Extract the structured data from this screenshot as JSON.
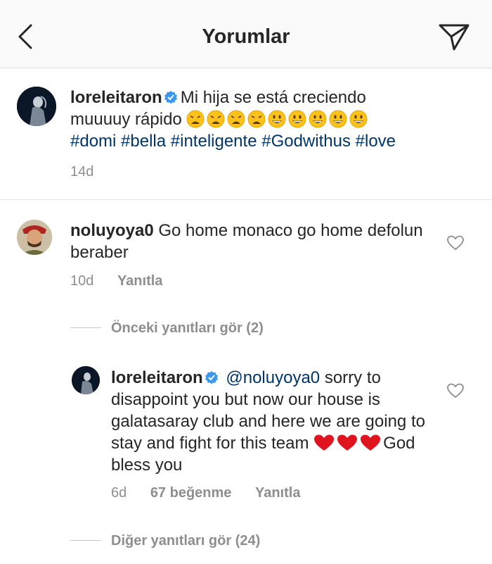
{
  "header": {
    "title": "Yorumlar"
  },
  "caption": {
    "username": "loreleitaron",
    "text_line1": "Mi hija se está creciendo",
    "text_line2": "muuuuy rápido",
    "emojis": [
      "weary",
      "weary",
      "weary",
      "weary",
      "smiley",
      "smiley",
      "smiley",
      "smiley",
      "smiley"
    ],
    "hashtags": [
      "#domi",
      "#bella",
      "#inteligente",
      "#Godwithus",
      "#love"
    ],
    "time": "14d"
  },
  "comment1": {
    "username": "noluyoya0",
    "text": "Go home monaco go home defolun beraber",
    "time": "10d",
    "reply_label": "Yanıtla"
  },
  "view_prev": "Önceki yanıtları gör (2)",
  "reply": {
    "username": "loreleitaron",
    "mention": "@noluyoya0",
    "text": "sorry to disappoint you but now our house is galatasaray club and here we are going to stay and fight for this team",
    "text_end": "God bless you",
    "time": "6d",
    "likes": "67 beğenme",
    "reply_label": "Yanıtla"
  },
  "view_more": "Diğer yanıtları gör (24)",
  "colors": {
    "hashtag": "#003569",
    "meta": "#8e8e8e",
    "verified": "#3897f0",
    "heart_red": "#e0141e"
  }
}
